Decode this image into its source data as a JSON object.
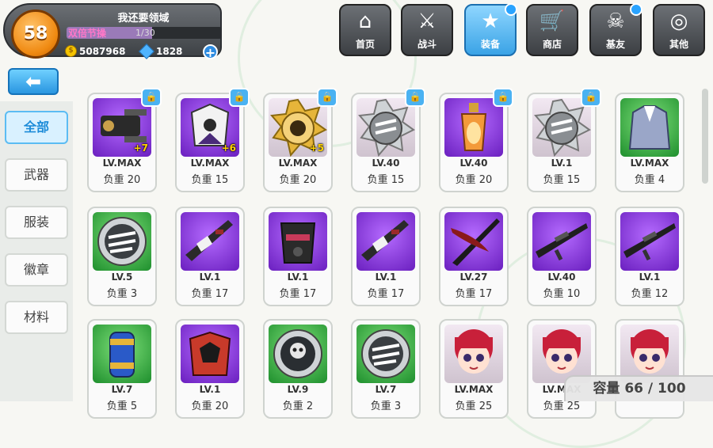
{
  "player": {
    "level": "58",
    "name": "我还要领域",
    "buff": "双倍节操",
    "exp_text": "1/30",
    "exp_progress": 0.55,
    "gold": "5087968",
    "gems": "1828"
  },
  "nav": [
    {
      "label": "首页",
      "icon": "house-icon",
      "glyph": "⌂",
      "active": false,
      "badge": false
    },
    {
      "label": "战斗",
      "icon": "crossed-guns-icon",
      "glyph": "⚔",
      "active": false,
      "badge": false
    },
    {
      "label": "装备",
      "icon": "star-gun-icon",
      "glyph": "★",
      "active": true,
      "badge": true
    },
    {
      "label": "商店",
      "icon": "cart-icon",
      "glyph": "🛒",
      "active": false,
      "badge": false
    },
    {
      "label": "基友",
      "icon": "skull-friends-icon",
      "glyph": "☠",
      "active": false,
      "badge": true
    },
    {
      "label": "其他",
      "icon": "settings-spiral-icon",
      "glyph": "◎",
      "active": false,
      "badge": false
    }
  ],
  "back": {
    "glyph": "⬅"
  },
  "side_tabs": [
    {
      "label": "全部",
      "active": true
    },
    {
      "label": "武器",
      "active": false
    },
    {
      "label": "服装",
      "active": false
    },
    {
      "label": "徽章",
      "active": false
    },
    {
      "label": "材料",
      "active": false
    }
  ],
  "items": [
    {
      "bg": "purple",
      "art": "gatling",
      "lv": "LV.MAX",
      "weight": "负重 20",
      "plus": "+7",
      "lock": true
    },
    {
      "bg": "purple",
      "art": "armor-white",
      "lv": "LV.MAX",
      "weight": "负重 15",
      "plus": "+6",
      "lock": true
    },
    {
      "bg": "badge-gold",
      "art": "gold-badge",
      "lv": "LV.MAX",
      "weight": "负重 20",
      "plus": "+5",
      "lock": true
    },
    {
      "bg": "badge-silver",
      "art": "silver-badge",
      "lv": "LV.40",
      "weight": "负重 15",
      "plus": "",
      "lock": true
    },
    {
      "bg": "purple",
      "art": "potion",
      "lv": "LV.40",
      "weight": "负重 20",
      "plus": "",
      "lock": true
    },
    {
      "bg": "badge-silver",
      "art": "silver-badge",
      "lv": "LV.1",
      "weight": "负重 15",
      "plus": "",
      "lock": true
    },
    {
      "bg": "green",
      "art": "coat",
      "lv": "LV.MAX",
      "weight": "负重 4",
      "plus": "",
      "lock": false
    },
    {
      "bg": "green",
      "art": "medal",
      "lv": "LV.5",
      "weight": "负重 3",
      "plus": "",
      "lock": false
    },
    {
      "bg": "purple",
      "art": "rifle",
      "lv": "LV.1",
      "weight": "负重 17",
      "plus": "",
      "lock": false
    },
    {
      "bg": "purple",
      "art": "helmet",
      "lv": "LV.1",
      "weight": "负重 17",
      "plus": "",
      "lock": false
    },
    {
      "bg": "purple",
      "art": "rifle",
      "lv": "LV.1",
      "weight": "负重 17",
      "plus": "",
      "lock": false
    },
    {
      "bg": "purple",
      "art": "scythe",
      "lv": "LV.27",
      "weight": "负重 17",
      "plus": "",
      "lock": false
    },
    {
      "bg": "purple",
      "art": "sniper",
      "lv": "LV.40",
      "weight": "负重 10",
      "plus": "",
      "lock": false
    },
    {
      "bg": "purple",
      "art": "sniper",
      "lv": "LV.1",
      "weight": "负重 12",
      "plus": "",
      "lock": false
    },
    {
      "bg": "green",
      "art": "canister",
      "lv": "LV.7",
      "weight": "负重 5",
      "plus": "",
      "lock": false
    },
    {
      "bg": "purple",
      "art": "armor-red",
      "lv": "LV.1",
      "weight": "负重 20",
      "plus": "",
      "lock": false
    },
    {
      "bg": "green",
      "art": "skull-medal",
      "lv": "LV.9",
      "weight": "负重 2",
      "plus": "",
      "lock": false
    },
    {
      "bg": "green",
      "art": "medal",
      "lv": "LV.7",
      "weight": "负重 3",
      "plus": "",
      "lock": false
    },
    {
      "bg": "chara",
      "art": "girl",
      "lv": "LV.MAX",
      "weight": "负重 25",
      "plus": "",
      "lock": false
    },
    {
      "bg": "chara",
      "art": "girl",
      "lv": "LV.MAX",
      "weight": "负重 25",
      "plus": "",
      "lock": false
    },
    {
      "bg": "chara",
      "art": "girl",
      "lv": "",
      "weight": "",
      "plus": "",
      "lock": false
    }
  ],
  "lock_glyph": "🔒",
  "capacity": "容量 66 / 100",
  "colors": {
    "accent": "#3aa3e6",
    "purple": "#8a3fe0",
    "green": "#2ea63a",
    "level_badge": "#f08a12"
  }
}
